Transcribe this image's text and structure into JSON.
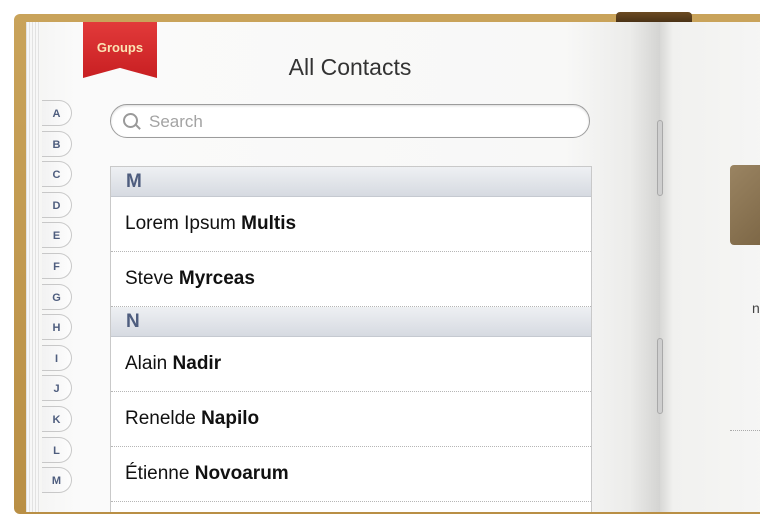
{
  "groups_ribbon": "Groups",
  "title": "All Contacts",
  "search": {
    "placeholder": "Search",
    "value": ""
  },
  "index_tabs": [
    "A",
    "B",
    "C",
    "D",
    "E",
    "F",
    "G",
    "H",
    "I",
    "J",
    "K",
    "L",
    "M"
  ],
  "sections": [
    {
      "letter": "M",
      "contacts": [
        {
          "first": "Lorem Ipsum",
          "last": "Multis"
        },
        {
          "first": "Steve",
          "last": "Myrceas"
        }
      ]
    },
    {
      "letter": "N",
      "contacts": [
        {
          "first": "Alain",
          "last": "Nadir"
        },
        {
          "first": "Renelde",
          "last": "Napilo"
        },
        {
          "first": "Étienne",
          "last": "Novoarum"
        }
      ]
    }
  ],
  "right_page": {
    "partial_text": "n"
  },
  "colors": {
    "ribbon": "#d32b2d",
    "section_text": "#4e5d7e",
    "leather": "#c29a50"
  }
}
